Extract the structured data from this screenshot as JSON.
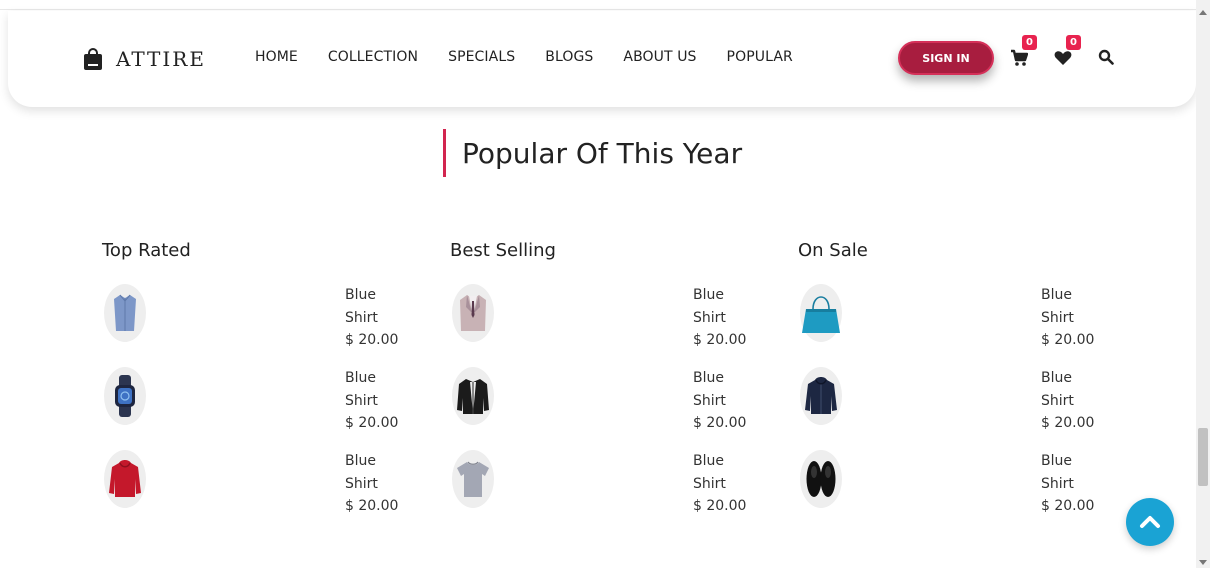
{
  "brand": {
    "name": "ATTIRE",
    "icon": "shopping-bag-icon"
  },
  "nav": {
    "items": [
      {
        "label": "HOME"
      },
      {
        "label": "COLLECTION"
      },
      {
        "label": "SPECIALS"
      },
      {
        "label": "BLOGS"
      },
      {
        "label": "ABOUT US"
      },
      {
        "label": "POPULAR"
      }
    ],
    "signin_label": "SIGN IN",
    "cart_count": "0",
    "wishlist_count": "0"
  },
  "colors": {
    "accent": "#a81d3f",
    "badge": "#e8234f",
    "title_bar": "#d2254f",
    "to_top": "#1aa3d4"
  },
  "section": {
    "title": "Popular Of This Year"
  },
  "columns": [
    {
      "title": "Top Rated",
      "products": [
        {
          "name": "Blue",
          "name2": "Shirt",
          "price": "$ 20.00",
          "image": "blue-shirt-icon"
        },
        {
          "name": "Blue",
          "name2": "Shirt",
          "price": "$ 20.00",
          "image": "smartwatch-icon"
        },
        {
          "name": "Blue",
          "name2": "Shirt",
          "price": "$ 20.00",
          "image": "red-hoodie-icon"
        }
      ]
    },
    {
      "title": "Best Selling",
      "products": [
        {
          "name": "Blue",
          "name2": "Shirt",
          "price": "$ 20.00",
          "image": "suit-icon"
        },
        {
          "name": "Blue",
          "name2": "Shirt",
          "price": "$ 20.00",
          "image": "black-jacket-icon"
        },
        {
          "name": "Blue",
          "name2": "Shirt",
          "price": "$ 20.00",
          "image": "grey-tshirt-icon"
        }
      ]
    },
    {
      "title": "On Sale",
      "products": [
        {
          "name": "Blue",
          "name2": "Shirt",
          "price": "$ 20.00",
          "image": "handbag-icon"
        },
        {
          "name": "Blue",
          "name2": "Shirt",
          "price": "$ 20.00",
          "image": "navy-hoodie-icon"
        },
        {
          "name": "Blue",
          "name2": "Shirt",
          "price": "$ 20.00",
          "image": "sneakers-icon"
        }
      ]
    }
  ]
}
